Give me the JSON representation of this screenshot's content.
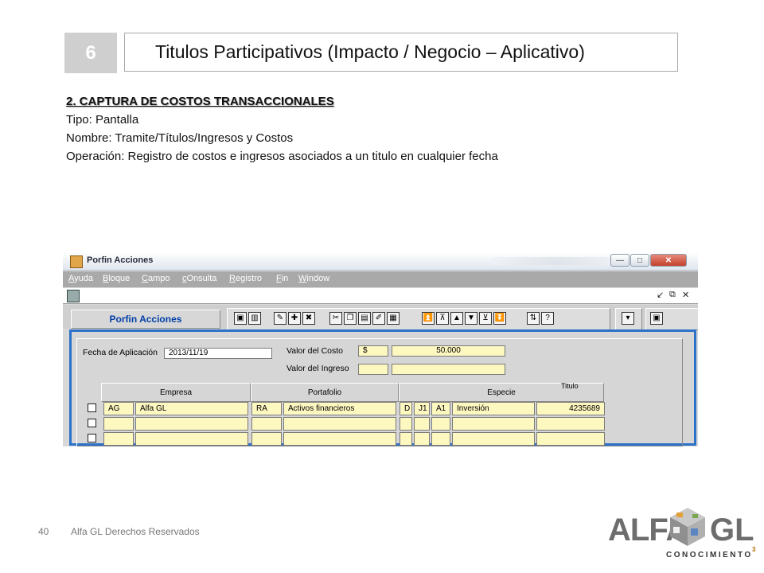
{
  "slide": {
    "number": "6",
    "title": "Titulos Participativos (Impacto / Negocio – Aplicativo)",
    "heading": "2. CAPTURA DE COSTOS TRANSACCIONALES",
    "lines": [
      "Tipo: Pantalla",
      "Nombre: Tramite/Títulos/Ingresos y Costos",
      "Operación: Registro de costos e ingresos asociados a un titulo en cualquier fecha"
    ],
    "footer_page": "40",
    "footer_text": "Alfa GL Derechos Reservados"
  },
  "logo": {
    "left": "ALFA",
    "right": "GL",
    "tagline": "CONOCIMIENTO",
    "superscript": "3"
  },
  "window": {
    "title": "Porfin Acciones",
    "menu": [
      "Ayuda",
      "Bloque",
      "Campo",
      "cOnsulta",
      "Registro",
      "Fin",
      "Window"
    ],
    "mdi_controls": [
      "↙",
      "⧉",
      "✕"
    ],
    "window_buttons": [
      "—",
      "□",
      "✕"
    ],
    "module_button": "Porfin Acciones",
    "toolbar": [
      {
        "name": "save-icon",
        "glyph": "▣"
      },
      {
        "name": "print-icon",
        "glyph": "▥"
      },
      {
        "name": "edit-icon",
        "glyph": "✎"
      },
      {
        "name": "add-icon",
        "glyph": "✚"
      },
      {
        "name": "delete-icon",
        "glyph": "✖"
      },
      {
        "name": "cut-icon",
        "glyph": "✂"
      },
      {
        "name": "copy-icon",
        "glyph": "❐"
      },
      {
        "name": "paste-icon",
        "glyph": "▤"
      },
      {
        "name": "edit-field-icon",
        "glyph": "✐"
      },
      {
        "name": "form-icon",
        "glyph": "▦"
      },
      {
        "name": "first-record-icon",
        "glyph": "⏫"
      },
      {
        "name": "prev-block-icon",
        "glyph": "⊼"
      },
      {
        "name": "prev-record-icon",
        "glyph": "▲"
      },
      {
        "name": "next-record-icon",
        "glyph": "▼"
      },
      {
        "name": "next-block-icon",
        "glyph": "⊻"
      },
      {
        "name": "last-record-icon",
        "glyph": "⏬"
      },
      {
        "name": "sort-icon",
        "glyph": "⇅"
      },
      {
        "name": "help-icon",
        "glyph": "?"
      }
    ],
    "dropdown_glyph": "▾",
    "extra_glyph": "▣"
  },
  "form": {
    "fecha_label": "Fecha de Aplicación",
    "fecha_value": "2013/11/19",
    "costo_label": "Valor del Costo",
    "costo_currency": "$",
    "costo_value": "50.000",
    "ingreso_label": "Valor del Ingreso",
    "headers": {
      "empresa": "Empresa",
      "portafolio": "Portafolio",
      "especie": "Especie",
      "titulo": "Titulo"
    },
    "rows": [
      {
        "emp_code": "AG",
        "emp_name": "Alfa GL",
        "port_code": "RA",
        "port_name": "Activos financieros",
        "d": "D",
        "j": "J1",
        "a": "A1",
        "especie": "Inversión",
        "titulo": "4235689"
      },
      {
        "emp_code": "",
        "emp_name": "",
        "port_code": "",
        "port_name": "",
        "d": "",
        "j": "",
        "a": "",
        "especie": "",
        "titulo": ""
      },
      {
        "emp_code": "",
        "emp_name": "",
        "port_code": "",
        "port_name": "",
        "d": "",
        "j": "",
        "a": "",
        "especie": "",
        "titulo": ""
      }
    ]
  }
}
